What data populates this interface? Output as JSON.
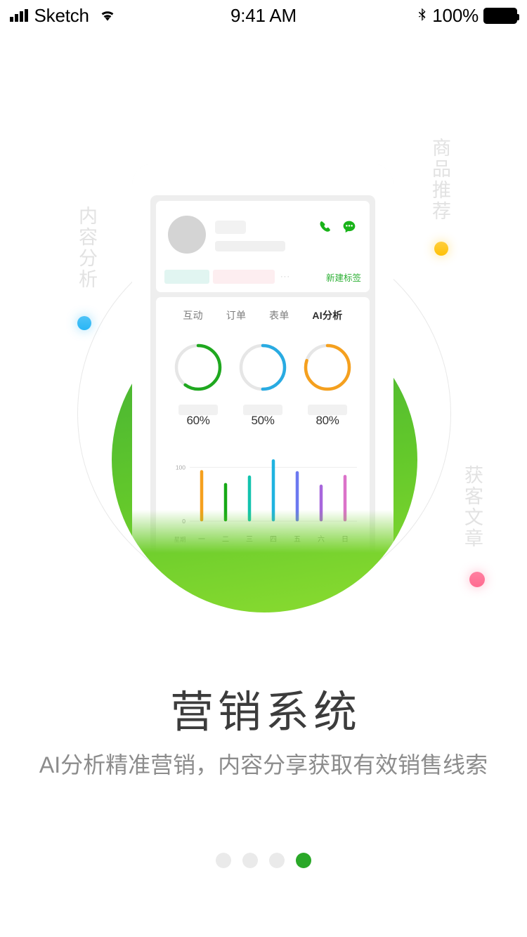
{
  "status_bar": {
    "carrier": "Sketch",
    "time": "9:41 AM",
    "battery_percent": "100%",
    "icons": [
      "signal-bars-icon",
      "wifi-icon",
      "bluetooth-icon",
      "battery-icon"
    ]
  },
  "illustration": {
    "side_labels": [
      {
        "name": "content-analysis",
        "text": "内容分析",
        "dot_color": "#29B6F6"
      },
      {
        "name": "product-recommendation",
        "text": "商品推荐",
        "dot_color": "#FFC107"
      },
      {
        "name": "customer-article",
        "text": "获客文章",
        "dot_color": "#FF6B90"
      }
    ],
    "background_circle": {
      "gradient_from": "#3FB618",
      "gradient_to": "#8BDC30"
    },
    "phone": {
      "contact_card": {
        "avatar": "avatar-placeholder",
        "name_placeholder": "",
        "detail_placeholder": "",
        "actions": [
          {
            "name": "call-icon",
            "color": "#19B319"
          },
          {
            "name": "chat-icon",
            "color": "#19B319"
          }
        ],
        "tags": [
          {
            "name": "tag-chip-cyan",
            "color": "#e1f5f1"
          },
          {
            "name": "tag-chip-pink",
            "color": "#fdeef0"
          }
        ],
        "more_dots": "···",
        "new_tag_label": "新建标签",
        "new_tag_color": "#2cb034"
      },
      "tabs": [
        {
          "label": "互动",
          "active": false
        },
        {
          "label": "订单",
          "active": false
        },
        {
          "label": "表单",
          "active": false
        },
        {
          "label": "AI分析",
          "active": true
        }
      ],
      "gauges": [
        {
          "label": "60%",
          "value": 60,
          "color": "#1FA81F"
        },
        {
          "label": "50%",
          "value": 50,
          "color": "#29ABE2"
        },
        {
          "label": "80%",
          "value": 80,
          "color": "#F5A01E"
        }
      ]
    }
  },
  "chart_data": {
    "type": "bar",
    "title": "",
    "xlabel": "星期",
    "ylabel": "",
    "categories": [
      "一",
      "二",
      "三",
      "四",
      "五",
      "六",
      "日"
    ],
    "values": [
      92,
      68,
      82,
      112,
      90,
      65,
      83
    ],
    "colors": [
      "#F5A01E",
      "#16A916",
      "#13C3AE",
      "#1FB3E0",
      "#6C79F0",
      "#A766DC",
      "#DB72C9"
    ],
    "ylim": [
      0,
      120
    ],
    "ytick_labels": [
      "0",
      "100"
    ],
    "ytick_values": [
      0,
      100
    ],
    "grid": true,
    "legend": "none"
  },
  "content": {
    "title": "营销系统",
    "subtitle": "AI分析精准营销，内容分享获取有效销售线索"
  },
  "pagination": {
    "total": 4,
    "active_index": 3,
    "active_color": "#2aa828",
    "inactive_color": "#eaeaea"
  }
}
